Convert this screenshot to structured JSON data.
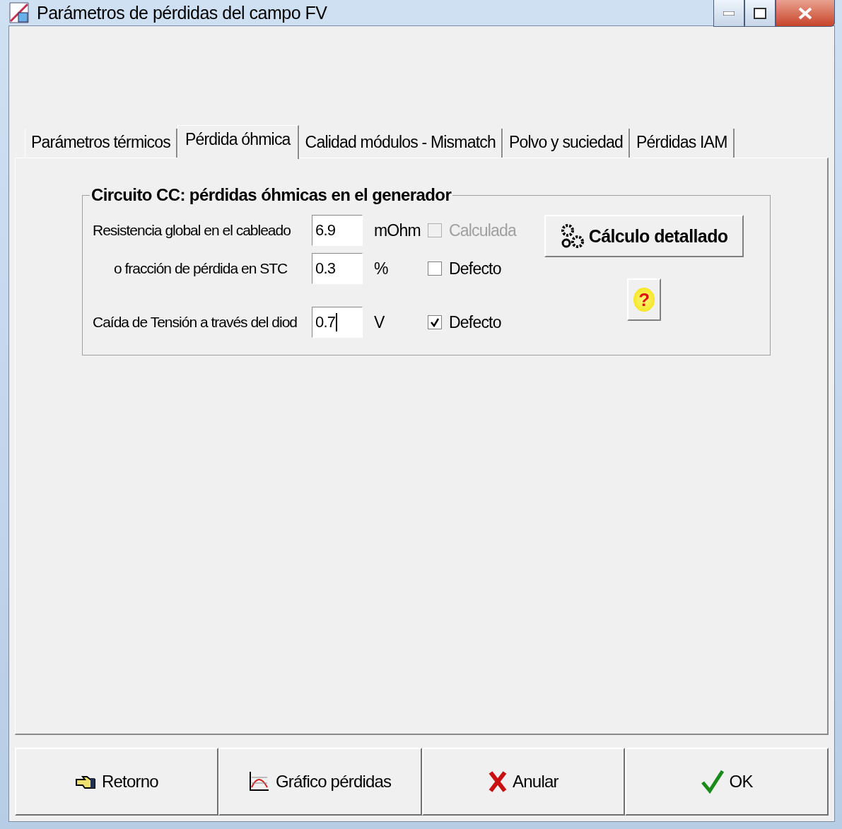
{
  "window": {
    "title": "Parámetros de pérdidas del campo FV"
  },
  "tabs": [
    {
      "label": "Parámetros térmicos",
      "selected": false
    },
    {
      "label": "Pérdida óhmica",
      "selected": true
    },
    {
      "label": "Calidad módulos - Mismatch",
      "selected": false
    },
    {
      "label": "Polvo y suciedad",
      "selected": false
    },
    {
      "label": "Pérdidas IAM",
      "selected": false
    }
  ],
  "group": {
    "title": "Circuito CC: pérdidas óhmicas en el generador",
    "rows": [
      {
        "label": "Resistencia global en el cableado",
        "value": "6.9",
        "unit": "mOhm",
        "focused": false,
        "checkbox": {
          "label": "Calculada",
          "checked": false,
          "disabled": true
        }
      },
      {
        "label": "o fracción de pérdida en STC",
        "value": "0.3",
        "unit": "%",
        "focused": false,
        "checkbox": {
          "label": "Defecto",
          "checked": false,
          "disabled": false
        }
      },
      {
        "label": "Caída de Tensión a través del diod",
        "value": "0.7",
        "unit": "V",
        "focused": true,
        "checkbox": {
          "label": "Defecto",
          "checked": true,
          "disabled": false
        }
      }
    ],
    "detail_button": "Cálculo detallado",
    "help_button": "?"
  },
  "footer_buttons": [
    {
      "kind": "back",
      "label": "Retorno"
    },
    {
      "kind": "chart",
      "label": "Gráfico pérdidas"
    },
    {
      "kind": "cancel",
      "label": "Anular"
    },
    {
      "kind": "ok",
      "label": "OK"
    }
  ]
}
